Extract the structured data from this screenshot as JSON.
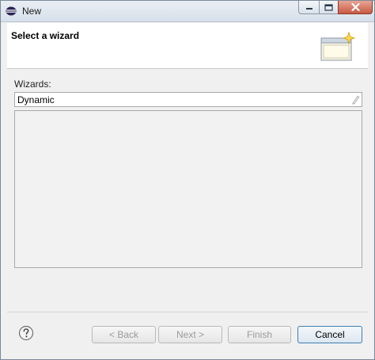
{
  "window": {
    "title": "New"
  },
  "header": {
    "page_title": "Select a wizard"
  },
  "filter": {
    "label": "Wizards:",
    "value": "Dynamic"
  },
  "wizard_list": {
    "items": []
  },
  "buttons": {
    "back": "< Back",
    "next": "Next >",
    "finish": "Finish",
    "cancel": "Cancel"
  },
  "icons": {
    "app": "eclipse-icon",
    "banner": "wizard-banner-icon",
    "clear": "clear-filter-icon",
    "help": "help-icon"
  },
  "colors": {
    "title_bar": "#dfe6ee",
    "close_button": "#c75a43",
    "dialog_background": "#f0f0f0",
    "disabled_text": "#9b9b9b",
    "focus_border": "#3c7fb1"
  },
  "state": {
    "back_enabled": false,
    "next_enabled": false,
    "finish_enabled": false,
    "cancel_enabled": true
  }
}
